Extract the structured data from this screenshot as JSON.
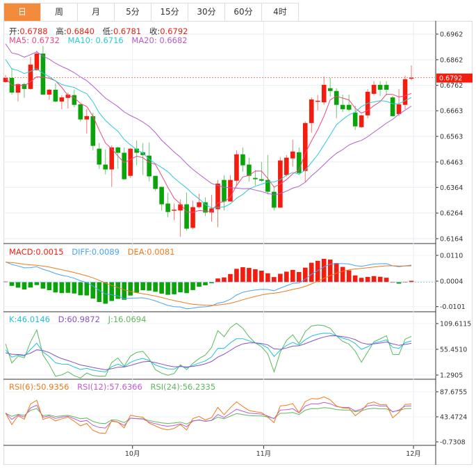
{
  "tabs": [
    {
      "label": "日",
      "active": true
    },
    {
      "label": "周",
      "active": false
    },
    {
      "label": "月",
      "active": false
    },
    {
      "label": "5分",
      "active": false
    },
    {
      "label": "15分",
      "active": false
    },
    {
      "label": "30分",
      "active": false
    },
    {
      "label": "60分",
      "active": false
    },
    {
      "label": "4时",
      "active": false
    }
  ],
  "ohlc_legend": {
    "open_label": "开:",
    "open": "0.6788",
    "high_label": "高:",
    "high": "0.6840",
    "low_label": "低:",
    "low": "0.6781",
    "close_label": "收:",
    "close": "0.6792"
  },
  "ma_legend": {
    "ma5": "MA5: 0.6732",
    "ma10": "MA10: 0.6716",
    "ma20": "MA20: 0.6682"
  },
  "macd_legend": {
    "macd": "MACD:0.0015",
    "diff": "DIFF:0.0089",
    "dea": "DEA:0.0081"
  },
  "kdj_legend": {
    "k": "K:46.0146",
    "d": "D:60.9872",
    "j": "J:16.0694"
  },
  "rsi_legend": {
    "rsi6": "RSI(6):50.9356",
    "rsi12": "RSI(12):57.6366",
    "rsi24": "RSI(24):56.2335"
  },
  "colors": {
    "up": "#f21d0f",
    "down": "#0aa30a",
    "ma5": "#f0487f",
    "ma10": "#2ec8da",
    "ma20": "#b25ccc",
    "diff": "#4aa3f0",
    "dea": "#f07a1c",
    "k": "#22c1d6",
    "d": "#8b4fc9",
    "j": "#5cb85c",
    "rsi6": "#f07a1c",
    "rsi12": "#c05ad0",
    "rsi24": "#5cb85c",
    "active_tab": "#f28c3c"
  },
  "chart_data": {
    "type": "candlestick",
    "current_price": "0.6792",
    "price_ticks": [
      "0.6962",
      "0.6862",
      "0.6762",
      "0.6663",
      "0.6563",
      "0.6463",
      "0.6364",
      "0.6264",
      "0.6164"
    ],
    "price_range": [
      0.6164,
      0.6962
    ],
    "macd_ticks": [
      "0.0110",
      "0.0004",
      "-0.0101"
    ],
    "kdj_ticks": [
      "109.6115",
      "55.4510",
      "1.2905"
    ],
    "rsi_ticks": [
      "87.6755",
      "43.4724",
      "-0.7308"
    ],
    "x_labels": [
      {
        "label": "10月",
        "index": 20
      },
      {
        "label": "11月",
        "index": 41
      },
      {
        "label": "12月",
        "index": 65
      }
    ],
    "candles": [
      [
        0.6775,
        0.6791,
        0.6802,
        0.6772
      ],
      [
        0.6791,
        0.6734,
        0.6829,
        0.6726
      ],
      [
        0.6734,
        0.6767,
        0.677,
        0.6699
      ],
      [
        0.6767,
        0.6748,
        0.6772,
        0.6713
      ],
      [
        0.6748,
        0.6843,
        0.6873,
        0.6745
      ],
      [
        0.6821,
        0.6886,
        0.6897,
        0.6821
      ],
      [
        0.6886,
        0.6726,
        0.6916,
        0.6726
      ],
      [
        0.6726,
        0.6745,
        0.6748,
        0.6707
      ],
      [
        0.6745,
        0.6699,
        0.677,
        0.6696
      ],
      [
        0.6699,
        0.6715,
        0.6724,
        0.6669
      ],
      [
        0.6713,
        0.6726,
        0.6734,
        0.6672
      ],
      [
        0.6724,
        0.6686,
        0.6745,
        0.6677
      ],
      [
        0.6688,
        0.6629,
        0.6688,
        0.6621
      ],
      [
        0.6629,
        0.6642,
        0.6669,
        0.6574
      ],
      [
        0.6642,
        0.6526,
        0.6656,
        0.6509
      ],
      [
        0.6515,
        0.6453,
        0.6537,
        0.6436
      ],
      [
        0.6453,
        0.6434,
        0.6512,
        0.6415
      ],
      [
        0.6434,
        0.652,
        0.6528,
        0.6366
      ],
      [
        0.652,
        0.6499,
        0.6523,
        0.6436
      ],
      [
        0.6499,
        0.6396,
        0.652,
        0.6393
      ],
      [
        0.6409,
        0.6515,
        0.6518,
        0.6401
      ],
      [
        0.6515,
        0.6499,
        0.6547,
        0.645
      ],
      [
        0.6501,
        0.649,
        0.6537,
        0.6412
      ],
      [
        0.6488,
        0.6407,
        0.6539,
        0.6387
      ],
      [
        0.6409,
        0.6358,
        0.6409,
        0.635
      ],
      [
        0.6366,
        0.6298,
        0.6366,
        0.6274
      ],
      [
        0.6301,
        0.6268,
        0.6344,
        0.6247
      ],
      [
        0.6274,
        0.6277,
        0.6301,
        0.6236
      ],
      [
        0.6274,
        0.6298,
        0.6317,
        0.6171
      ],
      [
        0.6298,
        0.6203,
        0.6344,
        0.6195
      ],
      [
        0.6206,
        0.6287,
        0.6312,
        0.6201
      ],
      [
        0.6287,
        0.6306,
        0.6339,
        0.6282
      ],
      [
        0.6306,
        0.6266,
        0.6325,
        0.6252
      ],
      [
        0.6266,
        0.6282,
        0.6335,
        0.623
      ],
      [
        0.6279,
        0.6379,
        0.6393,
        0.6209
      ],
      [
        0.6393,
        0.6309,
        0.6412,
        0.6274
      ],
      [
        0.6309,
        0.6393,
        0.6412,
        0.6309
      ],
      [
        0.639,
        0.6493,
        0.6509,
        0.6371
      ],
      [
        0.6493,
        0.645,
        0.652,
        0.6425
      ],
      [
        0.6453,
        0.6409,
        0.648,
        0.6387
      ],
      [
        0.6401,
        0.6396,
        0.6431,
        0.6371
      ],
      [
        0.6396,
        0.639,
        0.6463,
        0.6385
      ],
      [
        0.6393,
        0.6347,
        0.649,
        0.6336
      ],
      [
        0.6347,
        0.6285,
        0.6369,
        0.6274
      ],
      [
        0.6285,
        0.6469,
        0.6482,
        0.6285
      ],
      [
        0.6412,
        0.648,
        0.649,
        0.6407
      ],
      [
        0.6477,
        0.6504,
        0.655,
        0.6445
      ],
      [
        0.6501,
        0.642,
        0.652,
        0.6412
      ],
      [
        0.6428,
        0.6615,
        0.6621,
        0.6385
      ],
      [
        0.6615,
        0.6707,
        0.6715,
        0.6577
      ],
      [
        0.6699,
        0.6702,
        0.6724,
        0.6664
      ],
      [
        0.6696,
        0.6764,
        0.6797,
        0.6686
      ],
      [
        0.6751,
        0.674,
        0.6791,
        0.6718
      ],
      [
        0.674,
        0.6686,
        0.6751,
        0.6634
      ],
      [
        0.6686,
        0.6669,
        0.6726,
        0.6658
      ],
      [
        0.6686,
        0.6667,
        0.6726,
        0.6661
      ],
      [
        0.6656,
        0.6602,
        0.6683,
        0.6588
      ],
      [
        0.6599,
        0.6645,
        0.6648,
        0.6596
      ],
      [
        0.6645,
        0.6737,
        0.6748,
        0.6634
      ],
      [
        0.6729,
        0.6764,
        0.6778,
        0.6724
      ],
      [
        0.6764,
        0.6745,
        0.6778,
        0.6721
      ],
      [
        0.6764,
        0.6745,
        0.6778,
        0.6724
      ],
      [
        0.6715,
        0.6642,
        0.6721,
        0.664
      ],
      [
        0.665,
        0.6688,
        0.6748,
        0.6642
      ],
      [
        0.6686,
        0.6786,
        0.68,
        0.6669
      ],
      [
        0.6788,
        0.6792,
        0.684,
        0.6781
      ]
    ]
  }
}
